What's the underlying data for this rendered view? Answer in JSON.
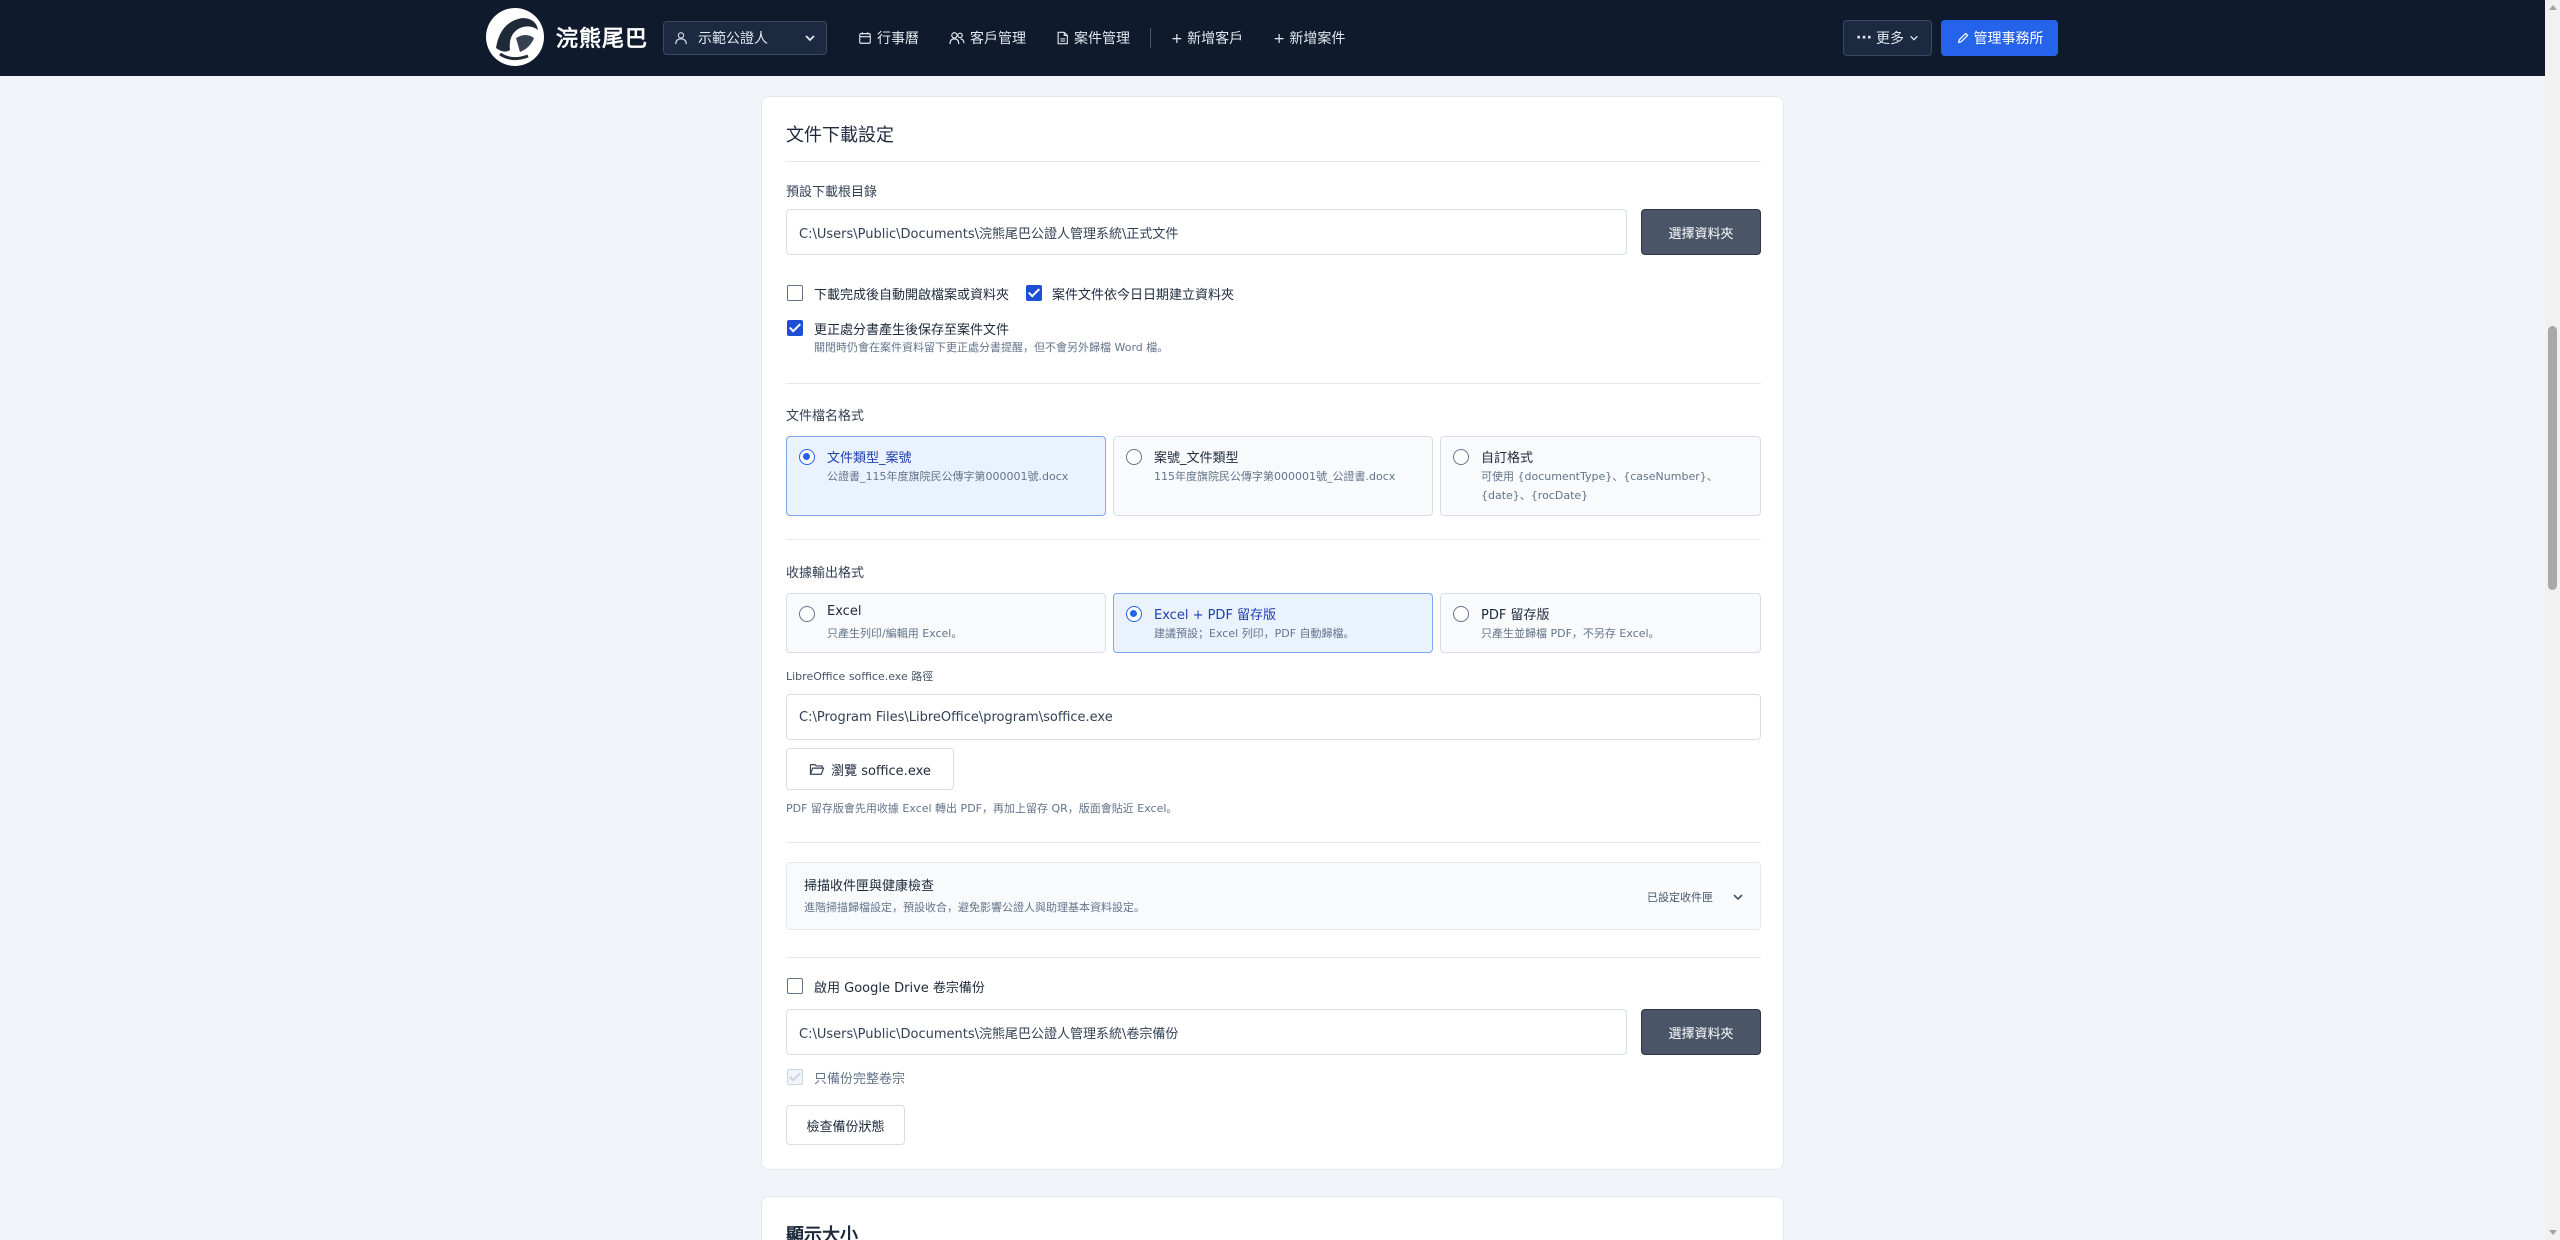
{
  "navbar": {
    "brand_name": "浣熊尾巴",
    "office_select": "示範公證人",
    "links": [
      {
        "label": "行事曆",
        "icon": "calendar-icon"
      },
      {
        "label": "客戶管理",
        "icon": "users-icon"
      },
      {
        "label": "案件管理",
        "icon": "file-icon"
      },
      {
        "label": "+ 新增客戶",
        "icon": ""
      },
      {
        "label": "+ 新增案件",
        "icon": ""
      }
    ],
    "more_label": "更多",
    "admin_label": "管理事務所",
    "colors": {
      "bg": "#0f1b2d",
      "accent": "#2563eb"
    }
  },
  "download_settings": {
    "title": "文件下載設定",
    "root_dir_label": "預設下載根目錄",
    "root_dir_value": "C:\\Users\\Public\\Documents\\浣熊尾巴公證人管理系統\\正式文件",
    "choose_folder": "選擇資料夾",
    "auto_open_label": "下載完成後自動開啟檔案或資料夾",
    "auto_open_checked": false,
    "date_folder_label": "案件文件依今日日期建立資料夾",
    "date_folder_checked": true,
    "save_correction_label": "更正處分書產生後保存至案件文件",
    "save_correction_checked": true,
    "save_correction_hint": "關閉時仍會在案件資料留下更正處分書提醒，但不會另外歸檔 Word 檔。"
  },
  "filename_format": {
    "label": "文件檔名格式",
    "options": [
      {
        "title": "文件類型_案號",
        "desc": "公證書_115年度旗院民公傳字第000001號.docx",
        "selected": true
      },
      {
        "title": "案號_文件類型",
        "desc": "115年度旗院民公傳字第000001號_公證書.docx",
        "selected": false
      },
      {
        "title": "自訂格式",
        "desc": "可使用 {documentType}、{caseNumber}、{date}、{rocDate}",
        "selected": false
      }
    ]
  },
  "receipt_format": {
    "label": "收據輸出格式",
    "options": [
      {
        "title": "Excel",
        "desc": "只產生列印/編輯用 Excel。",
        "selected": false
      },
      {
        "title": "Excel + PDF 留存版",
        "desc": "建議預設；Excel 列印，PDF 自動歸檔。",
        "selected": true
      },
      {
        "title": "PDF 留存版",
        "desc": "只產生並歸檔 PDF，不另存 Excel。",
        "selected": false
      }
    ],
    "soffice_label": "LibreOffice soffice.exe 路徑",
    "soffice_value": "C:\\Program Files\\LibreOffice\\program\\soffice.exe",
    "browse_label": "瀏覽 soffice.exe",
    "pdf_hint": "PDF 留存版會先用收據 Excel 轉出 PDF，再加上留存 QR，版面會貼近 Excel。"
  },
  "scan_folder": {
    "title": "掃描收件匣與健康檢查",
    "desc": "進階掃描歸檔設定，預設收合，避免影響公證人與助理基本資料設定。",
    "status": "已設定收件匣"
  },
  "backup": {
    "enable_label": "啟用 Google Drive 卷宗備份",
    "enable_checked": false,
    "path_value": "C:\\Users\\Public\\Documents\\浣熊尾巴公證人管理系統\\卷宗備份",
    "choose_folder": "選擇資料夾",
    "complete_only_label": "只備份完整卷宗",
    "check_status": "檢查備份狀態"
  },
  "display_size": {
    "title": "顯示大小"
  }
}
